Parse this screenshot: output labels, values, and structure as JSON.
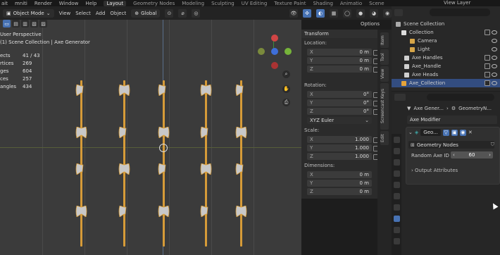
{
  "topbar": {
    "menus": [
      "ait",
      "mniti",
      "Render",
      "Window",
      "Help"
    ],
    "workspaces": [
      "Layout",
      "Geometry Nodes",
      "Modeling",
      "Sculpting",
      "UV Editing",
      "Texture Paint",
      "Shading",
      "Animatio",
      "Scene"
    ],
    "active_workspace": "Layout",
    "right_label": "View Layer"
  },
  "viewport_header": {
    "mode": "Object Mode",
    "menus": [
      "View",
      "Select",
      "Add",
      "Object"
    ],
    "transform": "Global"
  },
  "overlay": {
    "line1": "User Perspective",
    "line2": "(1) Scene Collection | Axe Generator"
  },
  "stats": [
    {
      "k": "ects",
      "v": "41 / 43"
    },
    {
      "k": "rtices",
      "v": "269"
    },
    {
      "k": "ges",
      "v": "604"
    },
    {
      "k": "ces",
      "v": "257"
    },
    {
      "k": "angles",
      "v": "434"
    }
  ],
  "npanel": {
    "title": "Transform",
    "options": "Options",
    "location_label": "Location:",
    "location": [
      {
        "axis": "X",
        "val": "0 m"
      },
      {
        "axis": "Y",
        "val": "0 m"
      },
      {
        "axis": "Z",
        "val": "0 m"
      }
    ],
    "rotation_label": "Rotation:",
    "rotation": [
      {
        "axis": "X",
        "val": "0°"
      },
      {
        "axis": "Y",
        "val": "0°"
      },
      {
        "axis": "Z",
        "val": "0°"
      }
    ],
    "rotation_mode": "XYZ Euler",
    "scale_label": "Scale:",
    "scale": [
      {
        "axis": "X",
        "val": "1.000"
      },
      {
        "axis": "Y",
        "val": "1.000"
      },
      {
        "axis": "Z",
        "val": "1.000"
      }
    ],
    "dimensions_label": "Dimensions:",
    "dimensions": [
      {
        "axis": "X",
        "val": "0 m"
      },
      {
        "axis": "Y",
        "val": "0 m"
      },
      {
        "axis": "Z",
        "val": "0 m"
      }
    ]
  },
  "side_tabs": [
    "Item",
    "Tool",
    "View",
    "Screencast Keys",
    "Edit"
  ],
  "outliner": {
    "rows": [
      {
        "label": "Scene Collection",
        "indent": 6,
        "color": "#aaaaaa"
      },
      {
        "label": "Collection",
        "indent": 14,
        "color": "#dddddd"
      },
      {
        "label": "Camera",
        "indent": 26,
        "color": "#d6a548"
      },
      {
        "label": "Light",
        "indent": 26,
        "color": "#d6a548"
      },
      {
        "label": "Axe Handles",
        "indent": 18,
        "color": "#cfcfcf"
      },
      {
        "label": "Axe_Handle",
        "indent": 18,
        "color": "#cfcfcf"
      },
      {
        "label": "Axe Heads",
        "indent": 18,
        "color": "#cfcfcf"
      },
      {
        "label": "Axe_Collection",
        "indent": 14,
        "color": "#e6a43a"
      }
    ]
  },
  "props": {
    "breadcrumb_obj": "Axe Gener...",
    "breadcrumb_mod": "GeometryN...",
    "object_label": "Axe Modifier",
    "modifier_name": "Geo...",
    "node_group": "Geometry Nodes",
    "param_label": "Random Axe ID",
    "param_value": "60",
    "output_label": "Output Attributes"
  },
  "accent_colors": {
    "axe_handle": "#d69b38",
    "axe_blade": "#c8c8c8",
    "selection": "#4772b3"
  }
}
